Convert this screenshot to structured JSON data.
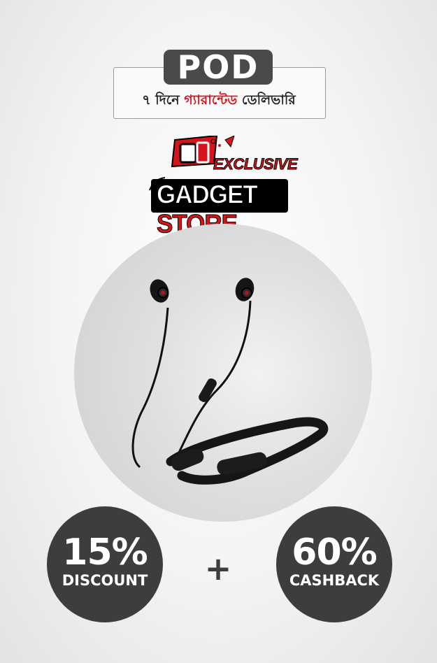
{
  "header": {
    "pod_label": "POD",
    "delivery_prefix": "৭ দিনে",
    "delivery_highlight": "গ্যারান্টেড",
    "delivery_suffix": "ডেলিভারি"
  },
  "logo": {
    "line1": "EXCLUSIVE",
    "line2_a": "GADGET",
    "line2_b": "STORE"
  },
  "product": {
    "name_icon": "neckband-earphones-image"
  },
  "offers": {
    "discount_value": "15%",
    "discount_label": "DISCOUNT",
    "plus_sign": "+",
    "cashback_value": "60%",
    "cashback_label": "CASHBACK"
  },
  "colors": {
    "accent_red": "#d5141b",
    "badge_dark": "#3d3d3d"
  }
}
